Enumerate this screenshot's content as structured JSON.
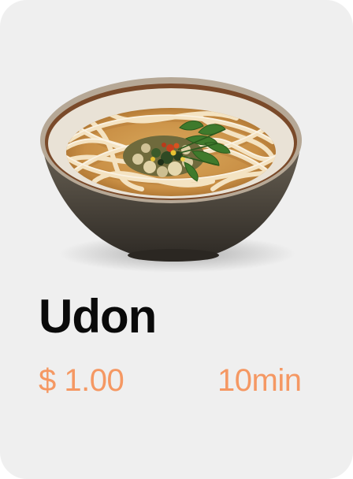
{
  "card": {
    "image_icon": "udon-bowl-image",
    "name": "Udon",
    "price": "$ 1.00",
    "time": "10min"
  },
  "colors": {
    "card_background": "#efefef",
    "accent": "#f59863",
    "title": "#0a0a0a"
  }
}
